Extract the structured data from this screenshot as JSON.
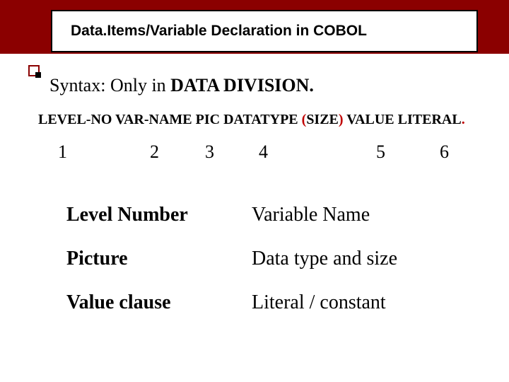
{
  "title": "Data.Items/Variable Declaration in COBOL",
  "syntax": {
    "label": "Syntax:  Only in ",
    "bold": "DATA DIVISION."
  },
  "format": {
    "p1": "LEVEL-NO",
    "sp1": "  ",
    "p2": "VAR-NAME",
    "sp2": "  ",
    "p3": "PIC",
    "sp3": "  ",
    "p4a": "DATATYPE ",
    "p4b_open": "(",
    "p4b_size": "SIZE",
    "p4b_close": ")",
    "sp4": "  ",
    "p5": "VALUE",
    "sp5": " ",
    "p6": "LITERAL",
    "dot": "."
  },
  "numbers": {
    "n1": "1",
    "n2": "2",
    "n3": "3",
    "n4": "4",
    "n5": "5",
    "n6": "6"
  },
  "defs": [
    {
      "left": "Level Number",
      "right": "Variable Name"
    },
    {
      "left": "Picture",
      "right": "Data type and size"
    },
    {
      "left": "Value clause",
      "right": "Literal / constant"
    }
  ]
}
